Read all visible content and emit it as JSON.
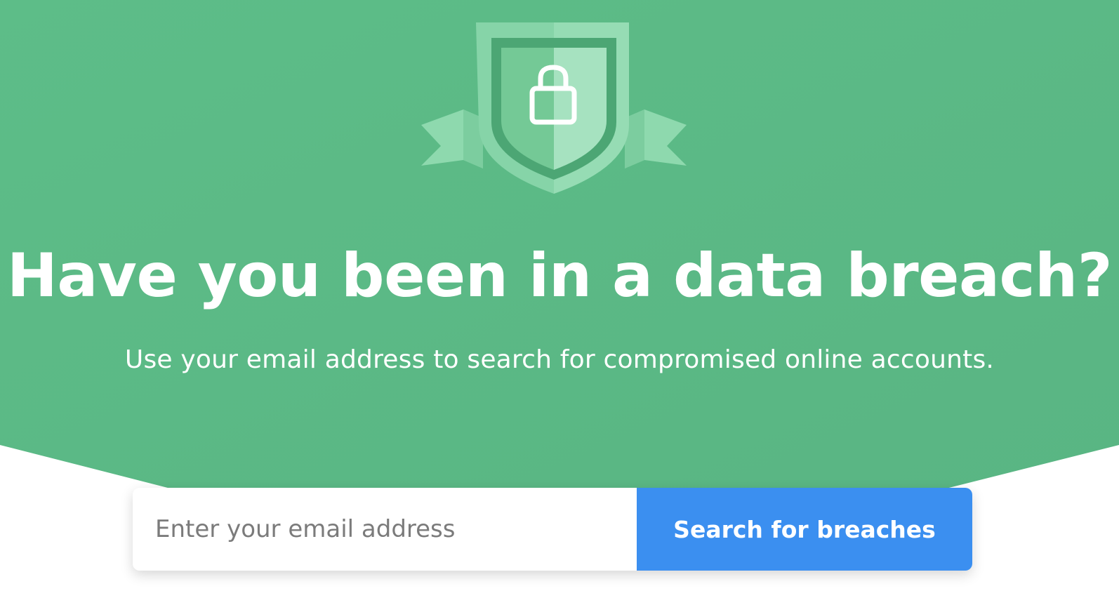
{
  "hero": {
    "headline": "Have you been in a data breach?",
    "subheadline": "Use your email address to search for compromised online accounts.",
    "background_color": "#5fbf8a",
    "logo_icon": "shield-lock-icon"
  },
  "search": {
    "email_placeholder": "Enter your email address",
    "email_value": "",
    "button_label": "Search for breaches",
    "button_color": "#3b8ff0"
  }
}
